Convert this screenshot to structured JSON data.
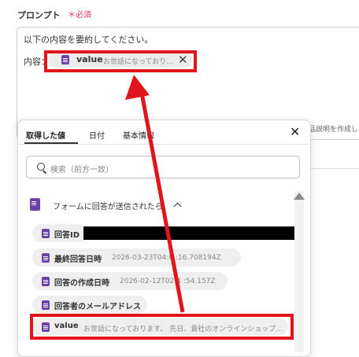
{
  "prompt": {
    "label": "プロンプト",
    "required": "＊必須",
    "line1": "以下の内容を要約してください。",
    "content_label": "内容：",
    "token": {
      "key": "value",
      "value": "お世話になっており..."
    }
  },
  "side_text": "品説明を作成し",
  "popup": {
    "tabs": [
      "取得した値",
      "日付",
      "基本情報"
    ],
    "search_placeholder": "検索（前方一致）",
    "section_title": "フォームに回答が送信されたら",
    "items": [
      {
        "label": "回答ID",
        "value": ""
      },
      {
        "label": "最終回答日時",
        "value": "2026-03-23T04:0 :16.708194Z"
      },
      {
        "label": "回答の作成日時",
        "value": "2026-02-12T02:4 :54.157Z"
      },
      {
        "label": "回答者のメールアドレス",
        "value": ""
      },
      {
        "label": "value",
        "value": "お世話になっております。 先日、貴社のオンラインショップ..."
      }
    ]
  },
  "colors": {
    "highlight": "#e0161c",
    "doc_icon": "#6b42a8",
    "required": "#e0306a"
  },
  "icons": [
    "doc-icon",
    "close-icon",
    "search-icon",
    "chevron-up-icon",
    "arrow-up-icon"
  ]
}
